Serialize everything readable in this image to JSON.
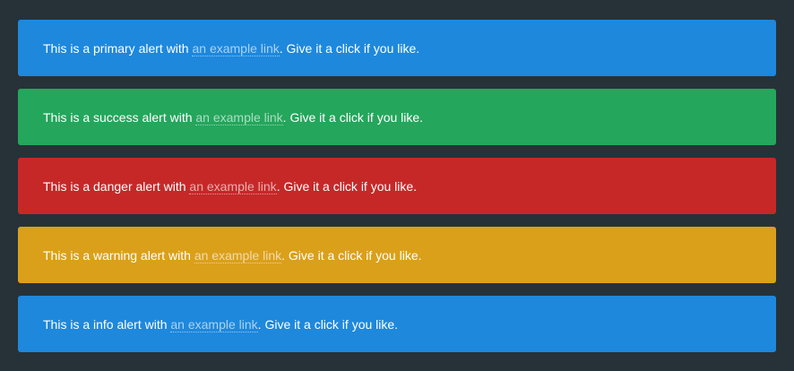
{
  "colors": {
    "background": "#263238",
    "primary": "#1e88dc",
    "success": "#24a65c",
    "danger": "#c62828",
    "warning": "#dba01a",
    "info": "#1e88dc"
  },
  "alerts": [
    {
      "variant": "primary",
      "before": "This is a primary alert with ",
      "link": "an example link",
      "after": ". Give it a click if you like."
    },
    {
      "variant": "success",
      "before": "This is a success alert with ",
      "link": "an example link",
      "after": ". Give it a click if you like."
    },
    {
      "variant": "danger",
      "before": "This is a danger alert with ",
      "link": "an example link",
      "after": ". Give it a click if you like."
    },
    {
      "variant": "warning",
      "before": "This is a warning alert with ",
      "link": "an example link",
      "after": ". Give it a click if you like."
    },
    {
      "variant": "info",
      "before": "This is a info alert with ",
      "link": "an example link",
      "after": ". Give it a click if you like."
    }
  ]
}
